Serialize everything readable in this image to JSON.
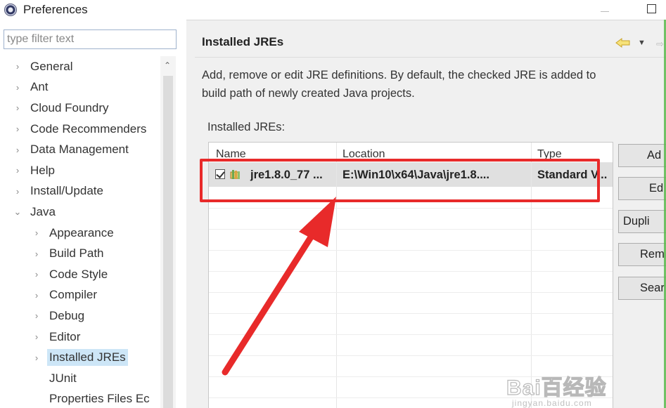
{
  "window": {
    "title": "Preferences",
    "app_icon": "eclipse-icon",
    "controls": [
      "minimize-icon",
      "maximize-icon"
    ]
  },
  "sidebar": {
    "filter_placeholder": "type filter text",
    "items": [
      {
        "label": "General",
        "level": 0,
        "expander": "collapsed"
      },
      {
        "label": "Ant",
        "level": 0,
        "expander": "collapsed"
      },
      {
        "label": "Cloud Foundry",
        "level": 0,
        "expander": "collapsed"
      },
      {
        "label": "Code Recommenders",
        "level": 0,
        "expander": "collapsed"
      },
      {
        "label": "Data Management",
        "level": 0,
        "expander": "collapsed"
      },
      {
        "label": "Help",
        "level": 0,
        "expander": "collapsed"
      },
      {
        "label": "Install/Update",
        "level": 0,
        "expander": "collapsed"
      },
      {
        "label": "Java",
        "level": 0,
        "expander": "expanded"
      },
      {
        "label": "Appearance",
        "level": 1,
        "expander": "collapsed"
      },
      {
        "label": "Build Path",
        "level": 1,
        "expander": "collapsed"
      },
      {
        "label": "Code Style",
        "level": 1,
        "expander": "collapsed"
      },
      {
        "label": "Compiler",
        "level": 1,
        "expander": "collapsed"
      },
      {
        "label": "Debug",
        "level": 1,
        "expander": "collapsed"
      },
      {
        "label": "Editor",
        "level": 1,
        "expander": "collapsed"
      },
      {
        "label": "Installed JREs",
        "level": 1,
        "expander": "collapsed",
        "selected": true
      },
      {
        "label": "JUnit",
        "level": 1,
        "expander": "none"
      },
      {
        "label": "Properties Files Ec",
        "level": 1,
        "expander": "none"
      }
    ]
  },
  "page": {
    "title": "Installed JREs",
    "description_line1": "Add, remove or edit JRE definitions. By default, the checked JRE is added to",
    "description_line2": "build path of newly created Java projects.",
    "list_label": "Installed JREs:",
    "nav_icons": [
      "back-icon",
      "dropdown-icon",
      "forward-icon"
    ]
  },
  "jre_table": {
    "columns": [
      "Name",
      "Location",
      "Type"
    ],
    "rows": [
      {
        "checked": true,
        "name": "jre1.8.0_77 ...",
        "location": "E:\\Win10\\x64\\Java\\jre1.8....",
        "type": "Standard V..."
      }
    ]
  },
  "buttons": {
    "add": "Ad",
    "edit": "Ed",
    "duplicate": "Dupli",
    "remove": "Rem",
    "search": "Sear"
  },
  "watermark": {
    "text": "Bai百经验",
    "sub": "jingyan.baidu.com"
  },
  "colors": {
    "annotation": "#e82a2a",
    "selection": "#cde6f7",
    "row_highlight": "#e0e0e0"
  }
}
